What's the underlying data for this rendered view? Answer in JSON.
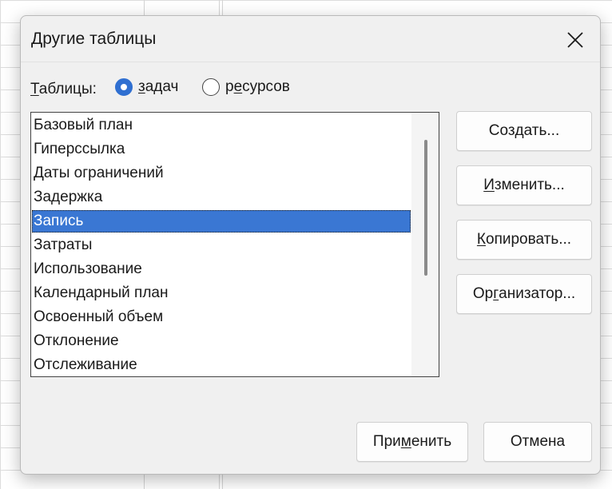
{
  "dialog": {
    "title": "Другие таблицы",
    "close_icon": "close-icon"
  },
  "table_type": {
    "label_first": "Т",
    "label_rest": "аблицы:",
    "options": [
      {
        "pre": "",
        "ul": "з",
        "post": "адач",
        "checked": true
      },
      {
        "pre": "р",
        "ul": "е",
        "post": "сурсов",
        "checked": false
      }
    ]
  },
  "list": {
    "items": [
      "Базовый план",
      "Гиперссылка",
      "Даты ограничений",
      "Задержка",
      "Запись",
      "Затраты",
      "Использование",
      "Календарный план",
      "Освоенный объем",
      "Отклонение",
      "Отслеживание"
    ],
    "selected_index": 4
  },
  "buttons": {
    "create": {
      "pre": "Соз",
      "ul": "д",
      "post": "ать..."
    },
    "edit": {
      "pre": "",
      "ul": "И",
      "post": "зменить..."
    },
    "copy": {
      "pre": "",
      "ul": "К",
      "post": "опировать..."
    },
    "organizer": {
      "pre": "Ор",
      "ul": "г",
      "post": "анизатор..."
    },
    "apply": {
      "pre": "При",
      "ul": "м",
      "post": "енить"
    },
    "cancel": {
      "pre": "Отмена",
      "ul": "",
      "post": ""
    }
  },
  "colors": {
    "accent": "#2f6fd1",
    "selection": "#3a77d3",
    "dialog_bg": "#f0f0f0"
  }
}
